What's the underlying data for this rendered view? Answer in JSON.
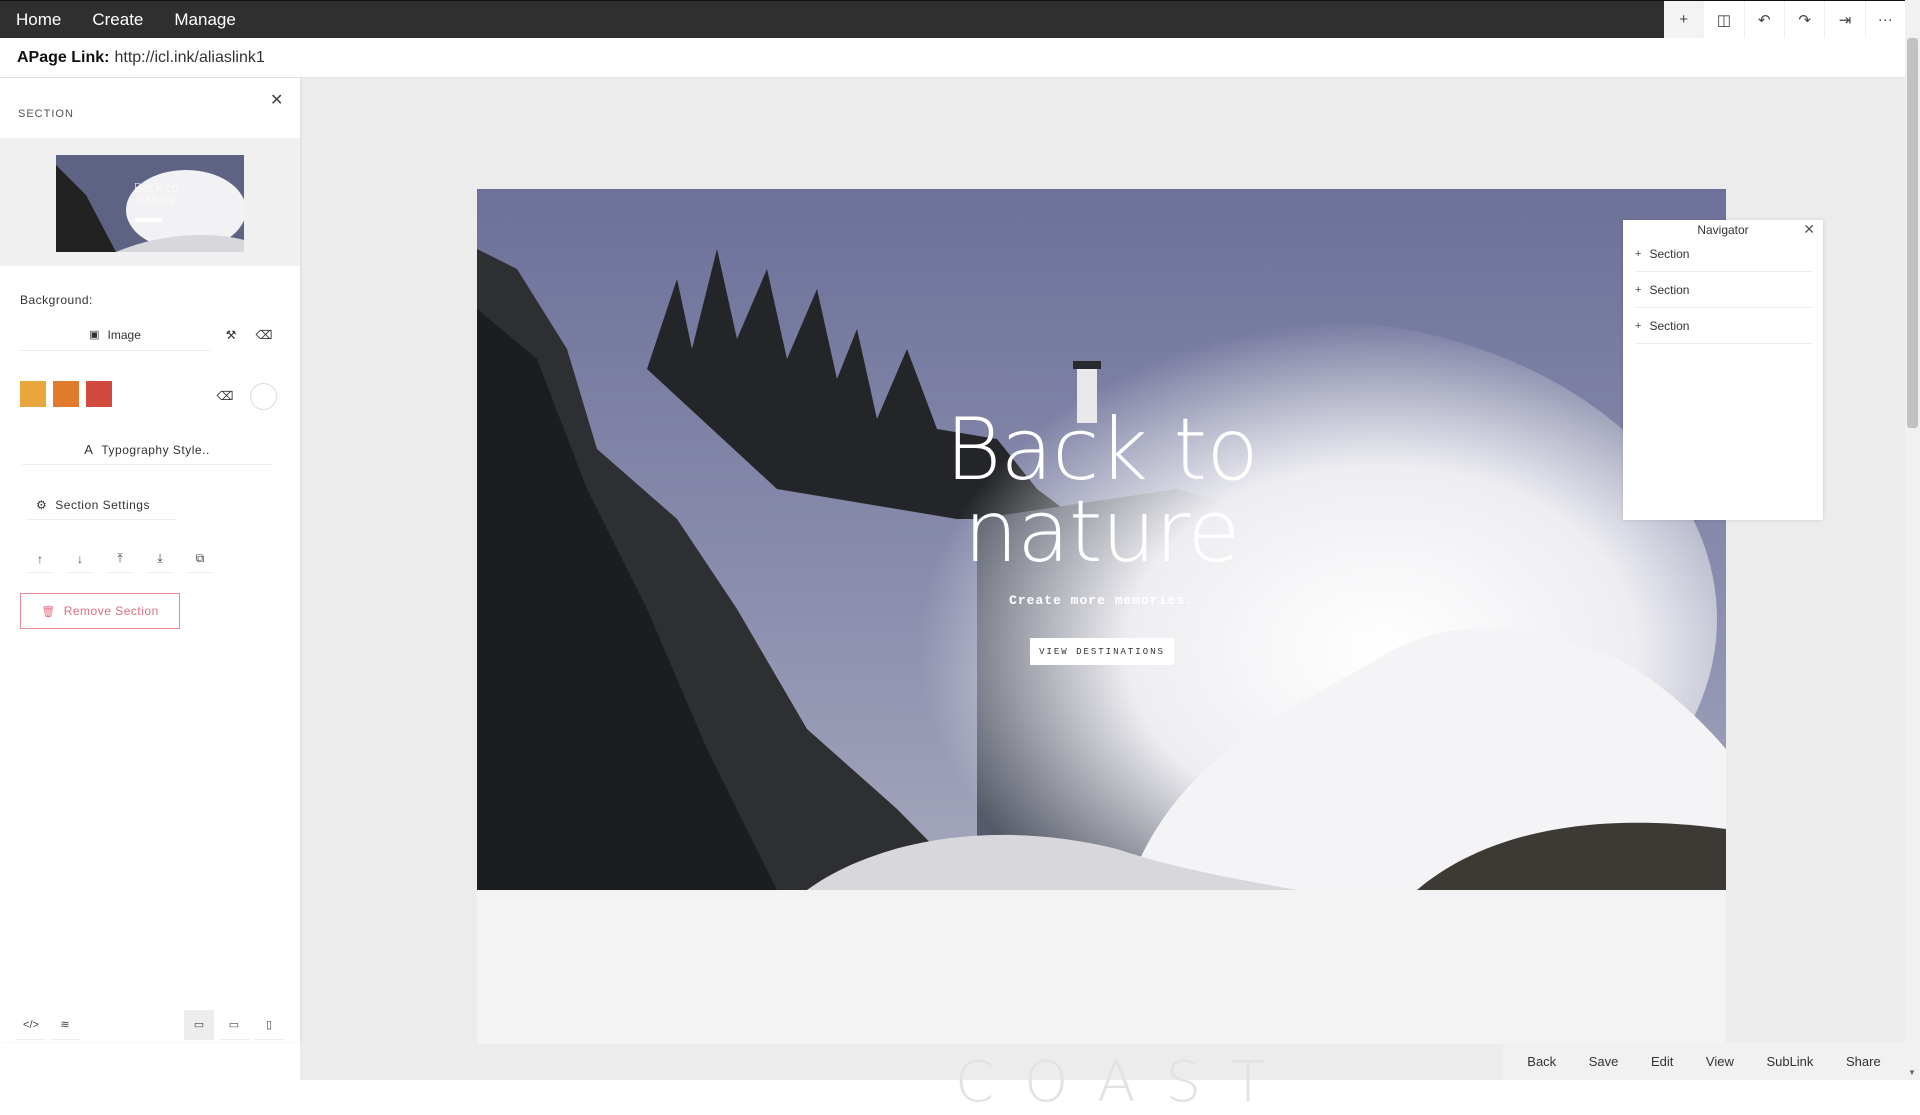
{
  "topnav": {
    "items": [
      "Home",
      "Create",
      "Manage"
    ]
  },
  "toolbar": {
    "icons": [
      "+",
      "◫",
      "↶",
      "↷",
      "⇥",
      "···"
    ]
  },
  "linkbar": {
    "label": "APage Link:",
    "url": "http://icl.ink/aliaslink1"
  },
  "panel": {
    "title": "SECTION",
    "close": "✕",
    "thumb_text": "Back to nature",
    "background_label": "Background:",
    "image_label": "Image",
    "typography_label": "Typography Style..",
    "settings_label": "Section Settings",
    "remove_label": "Remove Section",
    "swatches": [
      "#e8a63d",
      "#e07a2c",
      "#d24a3e"
    ],
    "arrows": [
      "↑",
      "↓",
      "⤒",
      "⤓",
      "⧉"
    ],
    "footer": [
      "</>",
      "≋",
      "▭",
      "▭",
      "▯"
    ]
  },
  "hero": {
    "title_line1": "Back to",
    "title_line2": "nature",
    "subtitle": "Create more memories.",
    "button": "VIEW DESTINATIONS"
  },
  "navigator": {
    "title": "Navigator",
    "close": "✕",
    "items": [
      "Section",
      "Section",
      "Section"
    ]
  },
  "actions": {
    "items": [
      "Back",
      "Save",
      "Edit",
      "View",
      "SubLink",
      "Share"
    ]
  },
  "ghost": "COAST"
}
